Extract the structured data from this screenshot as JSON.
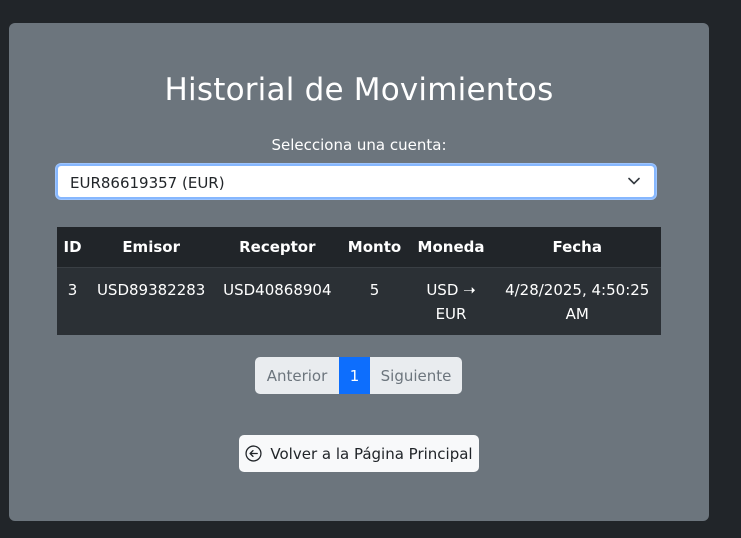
{
  "page": {
    "title": "Historial de Movimientos",
    "select_label": "Selecciona una cuenta:",
    "select_value": "EUR86619357 (EUR)"
  },
  "table": {
    "headers": [
      "ID",
      "Emisor",
      "Receptor",
      "Monto",
      "Moneda",
      "Fecha"
    ],
    "rows": [
      {
        "id": "3",
        "emisor": "USD89382283",
        "receptor": "USD40868904",
        "monto": "5",
        "moneda": "USD ➝ EUR",
        "fecha": "4/28/2025, 4:50:25 AM"
      }
    ]
  },
  "pagination": {
    "prev": "Anterior",
    "current": "1",
    "next": "Siguiente"
  },
  "back_button": {
    "label": "Volver a la Página Principal",
    "icon": "arrow-left-circle-icon"
  },
  "colors": {
    "background": "#212529",
    "card": "#6c757d",
    "accent": "#0d6efd"
  }
}
